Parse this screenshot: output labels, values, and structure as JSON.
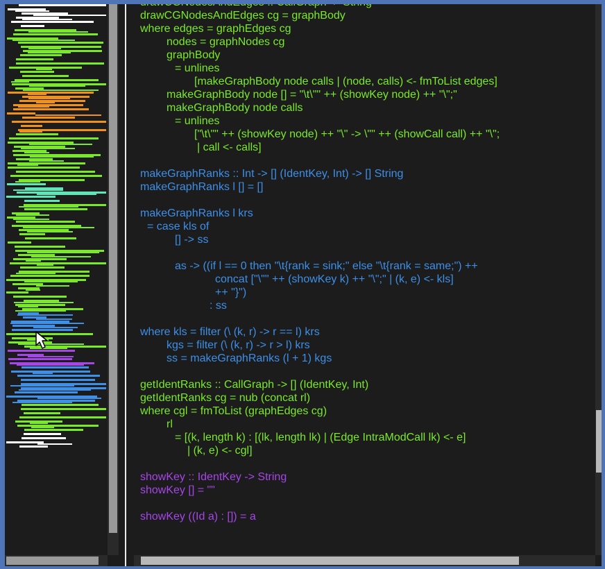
{
  "colors": {
    "green": "#7ae92a",
    "blue": "#3d8fe8",
    "purple": "#a646e8",
    "orange": "#f0901e",
    "teal": "#5ee6b8",
    "white": "#ffffff",
    "background": "#1c1c1c",
    "window_border": "#4f74b8"
  },
  "icons": {
    "cursor": "mouse-pointer-arrow"
  },
  "minimap": {
    "blocks": [
      {
        "color": "#ffffff",
        "lines": 6
      },
      {
        "color": "#7ae92a",
        "lines": 15
      },
      {
        "color": "#f0901e",
        "lines": 10
      },
      {
        "color": "#7ae92a",
        "lines": 12
      },
      {
        "color": "#5ee6b8",
        "lines": 5
      },
      {
        "color": "#7ae92a",
        "lines": 26
      },
      {
        "color": "#3d8fe8",
        "lines": 5
      },
      {
        "color": "#7ae92a",
        "lines": 4
      },
      {
        "color": "#a646e8",
        "lines": 4
      },
      {
        "color": "#3d8fe8",
        "lines": 9
      },
      {
        "color": "#7ae92a",
        "lines": 7
      },
      {
        "color": "#ffffff",
        "lines": 4
      }
    ]
  },
  "code_lines": [
    {
      "text": "drawCGNodesAndEdges :: CallGraph -> String",
      "color": "#7ae92a",
      "indent": 0
    },
    {
      "text": "drawCGNodesAndEdges cg = graphBody",
      "color": "#7ae92a",
      "indent": 0
    },
    {
      "text": "where edges = graphEdges cg",
      "color": "#7ae92a",
      "indent": 0
    },
    {
      "text": "nodes = graphNodes cg",
      "color": "#7ae92a",
      "indent": 38
    },
    {
      "text": "graphBody",
      "color": "#7ae92a",
      "indent": 38
    },
    {
      "text": "= unlines",
      "color": "#7ae92a",
      "indent": 50
    },
    {
      "text": "[makeGraphBody node calls | (node, calls) <- fmToList edges]",
      "color": "#7ae92a",
      "indent": 78
    },
    {
      "text": "makeGraphBody node [] = \"\\t\\\"\" ++ (showKey node) ++ \"\\\";\"",
      "color": "#7ae92a",
      "indent": 38
    },
    {
      "text": "makeGraphBody node calls",
      "color": "#7ae92a",
      "indent": 38
    },
    {
      "text": "= unlines",
      "color": "#7ae92a",
      "indent": 50
    },
    {
      "text": "[\"\\t\\\"\" ++ (showKey node) ++ \"\\\" -> \\\"\" ++ (showCall call) ++ \"\\\";",
      "color": "#7ae92a",
      "indent": 78
    },
    {
      "text": "| call <- calls]",
      "color": "#7ae92a",
      "indent": 82
    },
    {
      "text": "",
      "color": "#7ae92a",
      "indent": 0
    },
    {
      "text": "makeGraphRanks :: Int -> [] (IdentKey, Int) -> [] String",
      "color": "#3d8fe8",
      "indent": 0
    },
    {
      "text": "makeGraphRanks l [] = []",
      "color": "#3d8fe8",
      "indent": 0
    },
    {
      "text": "",
      "color": "#3d8fe8",
      "indent": 0
    },
    {
      "text": "makeGraphRanks l krs",
      "color": "#3d8fe8",
      "indent": 0
    },
    {
      "text": "= case kls of",
      "color": "#3d8fe8",
      "indent": 10
    },
    {
      "text": "[] -> ss",
      "color": "#3d8fe8",
      "indent": 50
    },
    {
      "text": "",
      "color": "#3d8fe8",
      "indent": 0
    },
    {
      "text": "as -> ((if l == 0 then \"\\t{rank = sink;\" else \"\\t{rank = same;\") ++",
      "color": "#3d8fe8",
      "indent": 50
    },
    {
      "text": "concat [\"\\\"\" ++ (showKey k) ++ \"\\\";\" | (k, e) <- kls]",
      "color": "#3d8fe8",
      "indent": 108
    },
    {
      "text": "++ \"}\")",
      "color": "#3d8fe8",
      "indent": 108
    },
    {
      "text": ": ss",
      "color": "#3d8fe8",
      "indent": 100
    },
    {
      "text": "",
      "color": "#3d8fe8",
      "indent": 0
    },
    {
      "text": "where kls = filter (\\ (k, r) -> r == l) krs",
      "color": "#3d8fe8",
      "indent": 0
    },
    {
      "text": "kgs = filter (\\ (k, r) -> r > l) krs",
      "color": "#3d8fe8",
      "indent": 38
    },
    {
      "text": "ss = makeGraphRanks (l + 1) kgs",
      "color": "#3d8fe8",
      "indent": 38
    },
    {
      "text": "",
      "color": "#7ae92a",
      "indent": 0
    },
    {
      "text": "getIdentRanks :: CallGraph -> [] (IdentKey, Int)",
      "color": "#7ae92a",
      "indent": 0
    },
    {
      "text": "getIdentRanks cg = nub (concat rl)",
      "color": "#7ae92a",
      "indent": 0
    },
    {
      "text": "where cgl = fmToList (graphEdges cg)",
      "color": "#7ae92a",
      "indent": 0
    },
    {
      "text": "rl",
      "color": "#7ae92a",
      "indent": 38
    },
    {
      "text": "= [(k, length k) : [(lk, length lk) | (Edge IntraModCall lk) <- e]",
      "color": "#7ae92a",
      "indent": 50
    },
    {
      "text": "| (k, e) <- cgl]",
      "color": "#7ae92a",
      "indent": 68
    },
    {
      "text": "",
      "color": "#a646e8",
      "indent": 0
    },
    {
      "text": "showKey :: IdentKey -> String",
      "color": "#a646e8",
      "indent": 0
    },
    {
      "text": "showKey [] = \"\"",
      "color": "#a646e8",
      "indent": 0
    },
    {
      "text": "",
      "color": "#a646e8",
      "indent": 0
    },
    {
      "text": "showKey ((Id a) : []) = a",
      "color": "#a646e8",
      "indent": 0
    }
  ]
}
